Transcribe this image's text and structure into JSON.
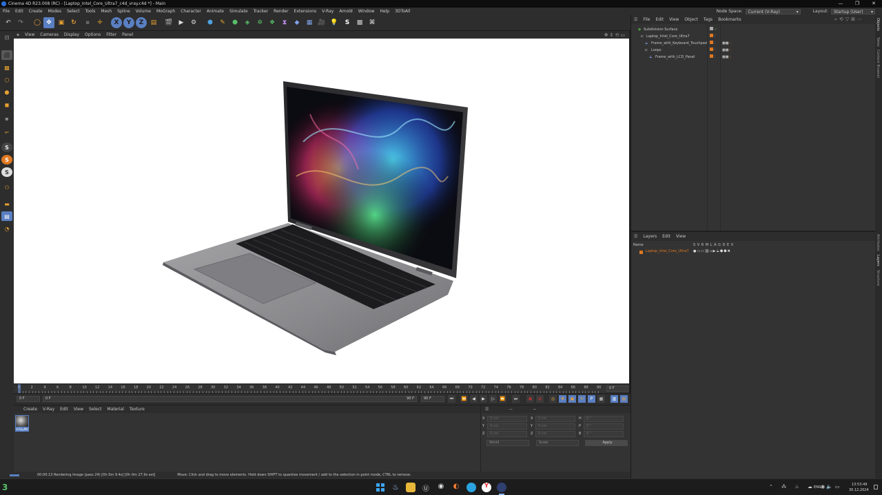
{
  "window": {
    "title": "Cinema 4D R23.008 (RC) - [Laptop_Intel_Core_Ultra7_c4d_vray.c4d *] - Main",
    "controls": [
      "—",
      "❐",
      "✕"
    ]
  },
  "menubar": {
    "items": [
      "File",
      "Edit",
      "Create",
      "Modes",
      "Select",
      "Tools",
      "Mesh",
      "Spline",
      "Volume",
      "MoGraph",
      "Character",
      "Animate",
      "Simulate",
      "Tracker",
      "Render",
      "Extensions",
      "V-Ray",
      "Arnold",
      "Window",
      "Help",
      "3DToAll"
    ],
    "node_space_label": "Node Space:",
    "node_space_value": "Current (V-Ray)",
    "layout_label": "Layout:",
    "layout_value": "Startup (User)"
  },
  "viewport_menu": [
    "View",
    "Cameras",
    "Display",
    "Options",
    "Filter",
    "Panel"
  ],
  "timeline": {
    "ticks": [
      "0",
      "2",
      "4",
      "6",
      "8",
      "10",
      "12",
      "14",
      "16",
      "18",
      "20",
      "22",
      "24",
      "26",
      "28",
      "30",
      "32",
      "34",
      "36",
      "38",
      "40",
      "42",
      "44",
      "46",
      "48",
      "50",
      "52",
      "54",
      "56",
      "58",
      "60",
      "62",
      "64",
      "66",
      "68",
      "70",
      "72",
      "74",
      "76",
      "78",
      "80",
      "82",
      "84",
      "86",
      "88",
      "90"
    ],
    "current_frame_display": "0 F"
  },
  "transport": {
    "start_field": "0 F",
    "min_field": "0 F",
    "max_field": "90 F",
    "end_field": "90 F"
  },
  "material_manager": {
    "menu": [
      "Create",
      "V-Ray",
      "Edit",
      "View",
      "Select",
      "Material",
      "Texture"
    ],
    "material_name": "V-RayMtl"
  },
  "coordinates": {
    "header_left": "--",
    "header_mid": "--",
    "rows": [
      {
        "a": "X",
        "av": "0 cm",
        "b": "X",
        "bv": "0 cm",
        "c": "H",
        "cv": "0 °"
      },
      {
        "a": "Y",
        "av": "0 cm",
        "b": "Y",
        "bv": "0 cm",
        "c": "P",
        "cv": "0 °"
      },
      {
        "a": "Z",
        "av": "0 cm",
        "b": "Z",
        "bv": "0 cm",
        "c": "B",
        "cv": "0 °"
      }
    ],
    "mode_dropdown": "World",
    "size_dropdown": "Scale",
    "apply_label": "Apply"
  },
  "status": {
    "render_status": "00:00:13 Rendering Image (pass 24) [0h 0m 9.4s] [0h 0m 27.9s est]",
    "hint": "Move: Click and drag to move elements. Hold down SHIFT to quantize movement / add to the selection in point mode, CTRL to remove."
  },
  "object_manager": {
    "menu": [
      "File",
      "Edit",
      "View",
      "Object",
      "Tags",
      "Bookmarks"
    ],
    "objects": [
      {
        "name": "Subdivision Surface",
        "indent": 0,
        "color": "#58b04a"
      },
      {
        "name": "Laptop_Intel_Core_Ultra7",
        "indent": 1,
        "color": "#e07820"
      },
      {
        "name": "Frame_with_Keyboard_Touchpad",
        "indent": 2,
        "color": "#e07820"
      },
      {
        "name": "Loops",
        "indent": 2,
        "color": "#e07820"
      },
      {
        "name": "Frame_with_LCD_Panel",
        "indent": 3,
        "color": "#e07820"
      }
    ]
  },
  "layer_manager": {
    "menu": [
      "Layers",
      "Edit",
      "View"
    ],
    "header_name": "Name",
    "columns": "S V R M L A G D E X",
    "layer_name": "Laptop_Intel_Core_Ultra7",
    "layer_color": "#e07820"
  },
  "right_tabs": [
    "Objects",
    "Takes",
    "Content Browser",
    "Attributes",
    "Layers",
    "Structure"
  ],
  "taskbar": {
    "lang": "ENG",
    "time": "13:53:49",
    "date": "30.12.2024"
  },
  "colors": {
    "accent_orange": "#e07820",
    "active_blue": "#5a7fc2",
    "green": "#58b04a"
  }
}
